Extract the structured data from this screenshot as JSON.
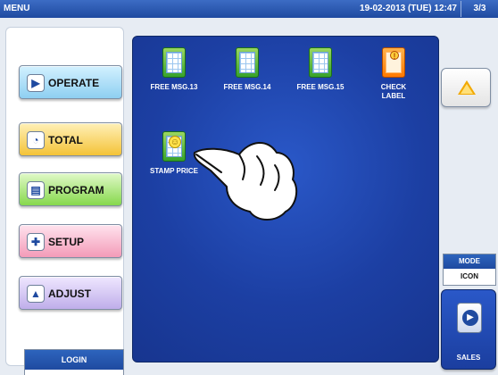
{
  "header": {
    "title": "MENU",
    "datetime": "19-02-2013 (TUE) 12:47",
    "page": "3/3"
  },
  "left_menu": {
    "items": [
      {
        "label": "OPERATE",
        "icon": "play-icon"
      },
      {
        "label": "TOTAL",
        "icon": "clock-icon"
      },
      {
        "label": "PROGRAM",
        "icon": "book-icon"
      },
      {
        "label": "SETUP",
        "icon": "wrench-icon"
      },
      {
        "label": "ADJUST",
        "icon": "scale-icon"
      }
    ]
  },
  "login": {
    "label": "LOGIN"
  },
  "tiles": [
    {
      "label": "FREE MSG.13"
    },
    {
      "label": "FREE MSG.14"
    },
    {
      "label": "FREE MSG.15"
    },
    {
      "label": "CHECK\nLABEL"
    },
    {
      "label": "STAMP PRICE"
    }
  ],
  "right": {
    "mode_label": "MODE",
    "mode_value": "ICON",
    "sales_label": "SALES"
  },
  "colors": {
    "topbar": "#1f4aa0",
    "main_panel": "#1c3fa3",
    "accent": "#f2a900"
  }
}
